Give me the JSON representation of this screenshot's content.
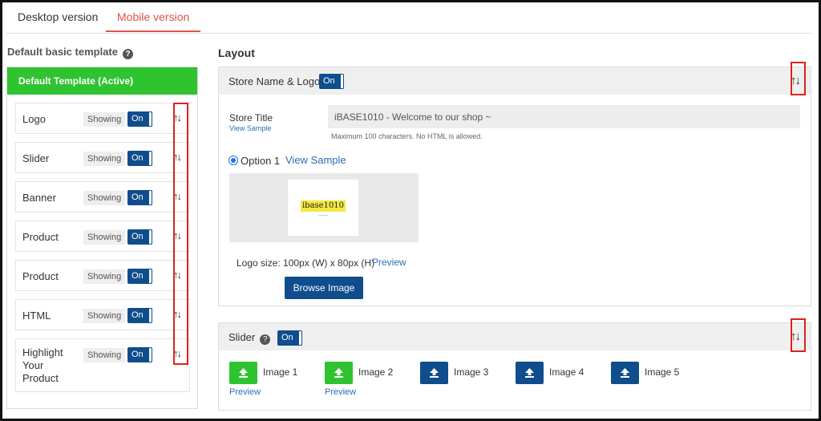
{
  "tabs": [
    {
      "label": "Desktop version"
    },
    {
      "label": "Mobile version",
      "active": true
    }
  ],
  "left": {
    "title": "Default basic template",
    "help_icon": "?",
    "active_template": "Default Template (Active)",
    "blocks": [
      {
        "name": "Logo",
        "status": "Showing",
        "toggle": "On"
      },
      {
        "name": "Slider",
        "status": "Showing",
        "toggle": "On"
      },
      {
        "name": "Banner",
        "status": "Showing",
        "toggle": "On"
      },
      {
        "name": "Product",
        "status": "Showing",
        "toggle": "On"
      },
      {
        "name": "Product",
        "status": "Showing",
        "toggle": "On"
      },
      {
        "name": "HTML",
        "status": "Showing",
        "toggle": "On"
      },
      {
        "name": "Highlight Your Product",
        "status": "Showing",
        "toggle": "On"
      }
    ],
    "arrows": "↑↓"
  },
  "layout": {
    "title": "Layout",
    "store": {
      "title": "Store Name & Logo",
      "toggle": "On",
      "arrows": "↑↓",
      "store_title_label": "Store Title",
      "view_sample": "View Sample",
      "store_title_value": "iBASE1010 - Welcome to our shop ~",
      "hint": "Maximum 100 characters. No HTML is allowed.",
      "option_label": "Option 1",
      "option_view_sample": "View Sample",
      "logo_text": "ibase1010",
      "logo_size": "Logo size: 100px (W) x 80px (H)",
      "logo_preview": "Preview",
      "browse_label": "Browse Image"
    },
    "slider": {
      "title": "Slider",
      "help_icon": "?",
      "toggle": "On",
      "arrows": "↑↓",
      "images": [
        {
          "label": "Image 1",
          "uploaded": true,
          "preview": "Preview"
        },
        {
          "label": "Image 2",
          "uploaded": true,
          "preview": "Preview"
        },
        {
          "label": "Image 3",
          "uploaded": false
        },
        {
          "label": "Image 4",
          "uploaded": false
        },
        {
          "label": "Image 5",
          "uploaded": false
        }
      ]
    }
  },
  "colors": {
    "active_green": "#2fc32f",
    "toggle_blue": "#0f4d8c",
    "tab_active_red": "#d9534f",
    "highlight_red": "#e02020",
    "link_blue": "#2a6db5"
  }
}
